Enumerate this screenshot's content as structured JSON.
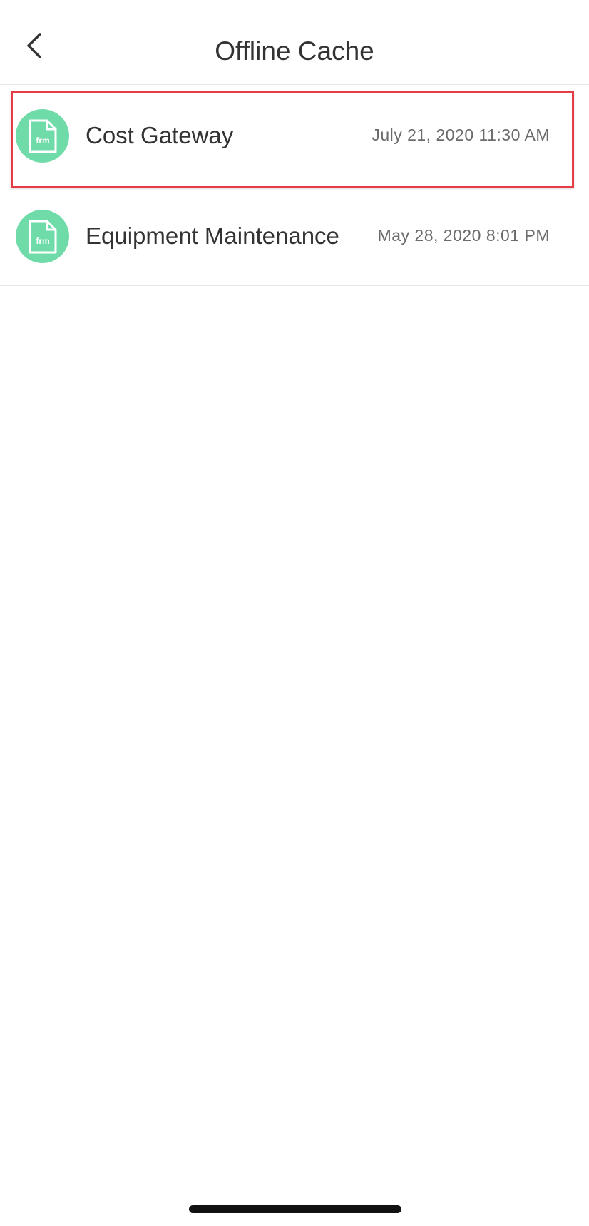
{
  "header": {
    "title": "Offline Cache",
    "back_icon": "chevron-left-icon"
  },
  "files": [
    {
      "name": "Cost Gateway",
      "date": "July 21, 2020 11:30 AM",
      "icon": "form-file-icon",
      "icon_label": "frm",
      "highlighted": true
    },
    {
      "name": "Equipment Maintenance",
      "date": "May 28, 2020 8:01 PM",
      "icon": "form-file-icon",
      "icon_label": "frm",
      "highlighted": false
    }
  ],
  "colors": {
    "avatar": "#6fdba9",
    "highlight": "#e53c45",
    "text": "#333333",
    "date_text": "#6b6b6b"
  }
}
